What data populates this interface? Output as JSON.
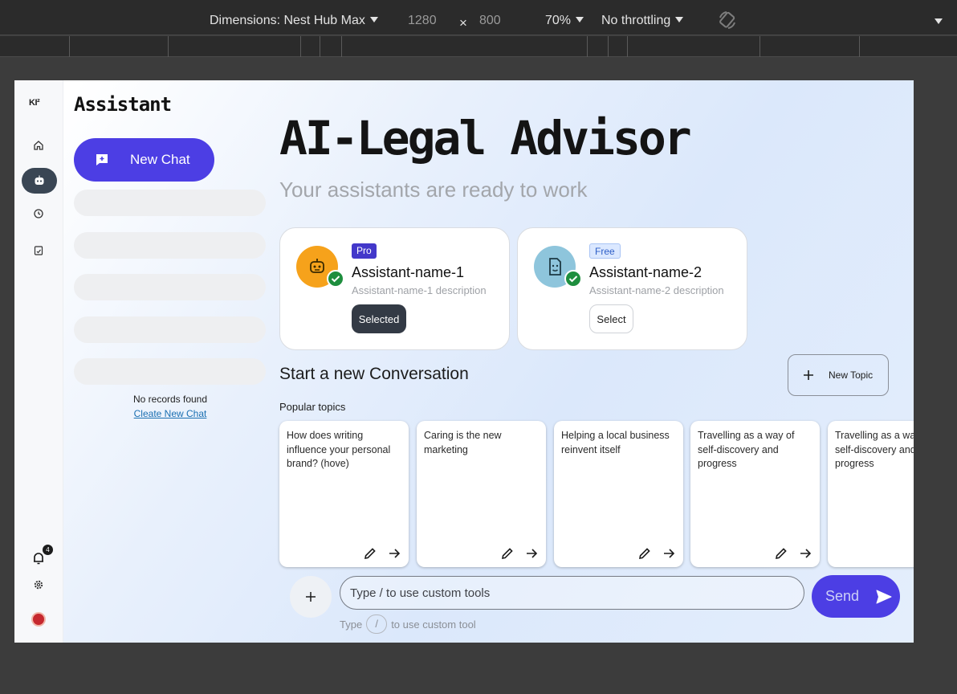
{
  "devtools": {
    "dimensions_label": "Dimensions: Nest Hub Max",
    "width": "1280",
    "times": "×",
    "height": "800",
    "zoom": "70%",
    "throttling": "No throttling"
  },
  "rail": {
    "logo_text": "KI²",
    "nav_icons": [
      "home-icon",
      "bot-icon",
      "history-icon",
      "document-check-icon"
    ],
    "bottom_icons": [
      "bell-icon",
      "gear-icon",
      "avatar"
    ],
    "notification_count": "4"
  },
  "sidebar": {
    "brand": "Assistant",
    "new_chat_label": "New Chat",
    "empty_text": "No records found",
    "create_link": "Cleate New Chat"
  },
  "main": {
    "title": "AI-Legal Advisor",
    "subtitle": "Your assistants are ready to work",
    "assistants": [
      {
        "tag": "Pro",
        "name": "Assistant-name-1",
        "description": "Assistant-name-1 description",
        "button": "Selected"
      },
      {
        "tag": "Free",
        "name": "Assistant-name-2",
        "description": "Assistant-name-2 description",
        "button": "Select"
      }
    ],
    "start_heading": "Start a new Conversation",
    "new_topic_label": "New Topic",
    "popular_label": "Popular topics",
    "topics": [
      "How does writing influence your personal brand? (hove)",
      "Caring is the new marketing",
      "Helping a local business reinvent itself",
      "Travelling as a way of self-discovery and progress",
      "Travelling as a way of self-discovery and progress"
    ]
  },
  "composer": {
    "placeholder": "Type / to use custom tools",
    "send_label": "Send",
    "hint_prefix": "Type",
    "hint_key": "/",
    "hint_suffix": "to use custom tool"
  },
  "colors": {
    "accent": "#4c3ee4",
    "pro_tag_bg": "#4338ca",
    "free_tag_bg": "#dbe8ff",
    "selected_button_bg": "#333a45",
    "check_green": "#1e8e3e",
    "avatar_orange": "#f6a21b",
    "avatar_teal": "#8ec5dc"
  }
}
